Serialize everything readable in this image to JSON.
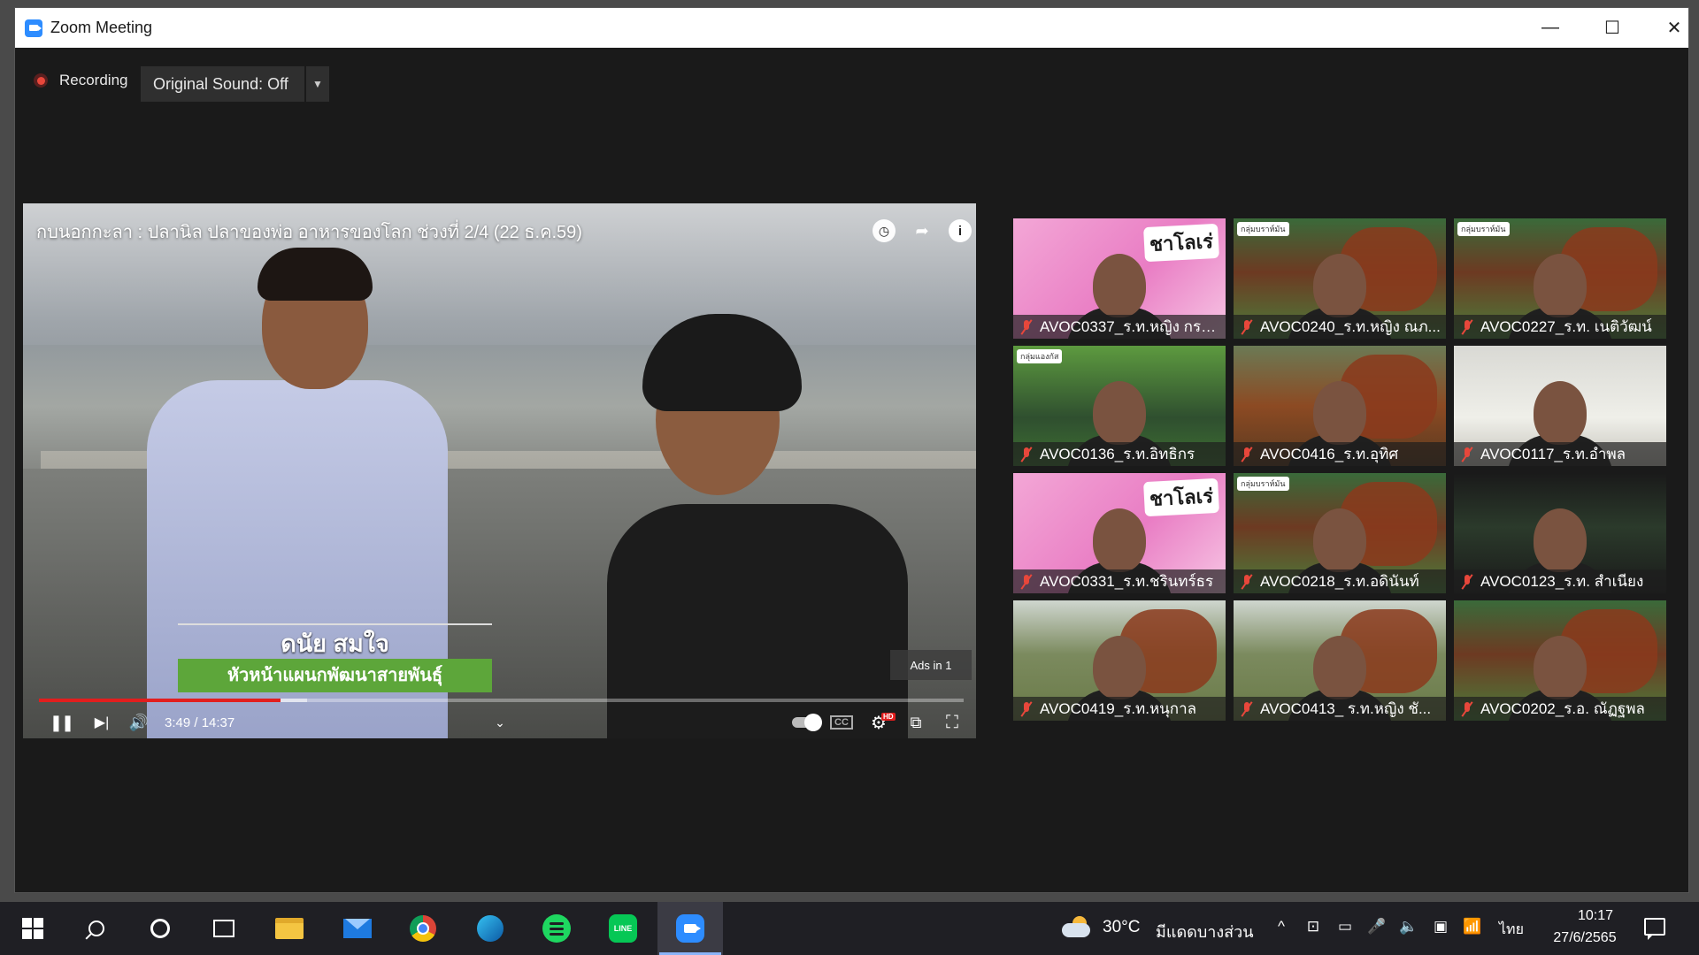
{
  "window": {
    "title": "Zoom Meeting",
    "minimize_glyph": "—",
    "maximize_glyph": "☐",
    "close_glyph": "✕"
  },
  "toolbar": {
    "recording_label": "Recording",
    "original_sound_label": "Original Sound: Off",
    "dropdown_glyph": "▼"
  },
  "video": {
    "title": "กบนอกกะลา : ปลานิล ปลาของพ่อ อาหารของโลก ช่วงที่ 2/4 (22 ธ.ค.59)",
    "caption_name": "ดนัย สมใจ",
    "caption_role": "หัวหน้าแผนกพัฒนาสายพันธุ์",
    "ads_label": "Ads in 1",
    "time": "3:49 / 14:37",
    "progress_fraction": 0.261,
    "buffer_fraction": 0.29,
    "info_glyph": "i",
    "clock_glyph": "◷",
    "share_glyph": "➦",
    "pause_glyph": "❚❚",
    "next_glyph": "▶|",
    "volume_glyph": "🔊",
    "chevron_glyph": "⌄",
    "cc_label": "CC",
    "settings_glyph": "⚙",
    "hd_label": "HD",
    "cast_glyph": "⧉",
    "fullscreen_glyph": "⛶"
  },
  "participants": [
    {
      "name": "AVOC0337_ร.ท.หญิง กรร...",
      "theme": "pink",
      "sticker": "ชาโลเร่"
    },
    {
      "name": "AVOC0240_ร.ท.หญิง ณภ...",
      "theme": "red",
      "tag": "กลุ่มบราห์มัน"
    },
    {
      "name": "AVOC0227_ร.ท. เนติวัฒน์",
      "theme": "red",
      "tag": "กลุ่มบราห์มัน"
    },
    {
      "name": "AVOC0136_ร.ท.อิทธิกร",
      "theme": "green",
      "tag": "กลุ่มแองกัส"
    },
    {
      "name": "AVOC0416_ร.ท.อุทิศ",
      "theme": "brown"
    },
    {
      "name": "AVOC0117_ร.ท.อำพล",
      "theme": "white"
    },
    {
      "name": "AVOC0331_ร.ท.ชรินทร์ธร",
      "theme": "pink",
      "sticker": "ชาโลเร่"
    },
    {
      "name": "AVOC0218_ร.ท.อดินันท์",
      "theme": "red",
      "tag": "กลุ่มบราห์มัน"
    },
    {
      "name": "AVOC0123_ร.ท. สำเนียง",
      "theme": "dark"
    },
    {
      "name": "AVOC0419_ร.ท.หนุกาล",
      "theme": "field"
    },
    {
      "name": "AVOC0413_ ร.ท.หญิง ชั...",
      "theme": "field"
    },
    {
      "name": "AVOC0202_ร.อ. ณัฏฐพล",
      "theme": "red"
    }
  ],
  "taskbar": {
    "weather_temp": "30°C",
    "weather_desc": "มีแดดบางส่วน",
    "language": "ไทย",
    "time": "10:17",
    "date": "27/6/2565",
    "line_label": "LINE",
    "tray_chevron": "^",
    "tray_meet": "⊡",
    "tray_battery": "▭",
    "tray_mic": "🎤",
    "tray_volume": "🔈",
    "tray_display": "▣",
    "tray_wifi": "📶"
  }
}
